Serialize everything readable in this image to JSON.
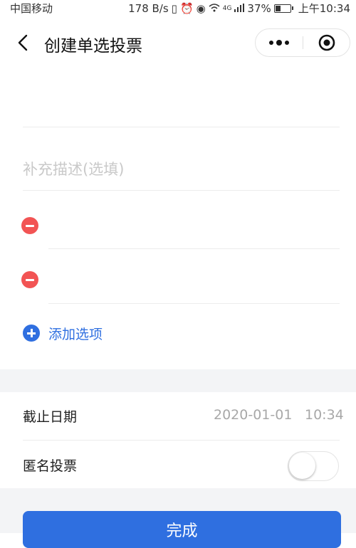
{
  "status_bar": {
    "carrier": "中国移动",
    "speed": "178 B/s",
    "network": "4G",
    "battery": "37%",
    "time": "上午10:34"
  },
  "nav": {
    "title": "创建单选投票"
  },
  "form": {
    "title_value": "",
    "description_placeholder": "补充描述(选填)",
    "options": [
      {
        "value": ""
      },
      {
        "value": ""
      }
    ],
    "add_option_label": "添加选项"
  },
  "settings": {
    "deadline_label": "截止日期",
    "deadline_date": "2020-01-01",
    "deadline_time": "10:34",
    "anonymous_label": "匿名投票",
    "anonymous_enabled": false
  },
  "actions": {
    "done_label": "完成"
  },
  "colors": {
    "accent": "#2f6fe0",
    "danger": "#f25454",
    "placeholder": "#c9c9c9"
  }
}
